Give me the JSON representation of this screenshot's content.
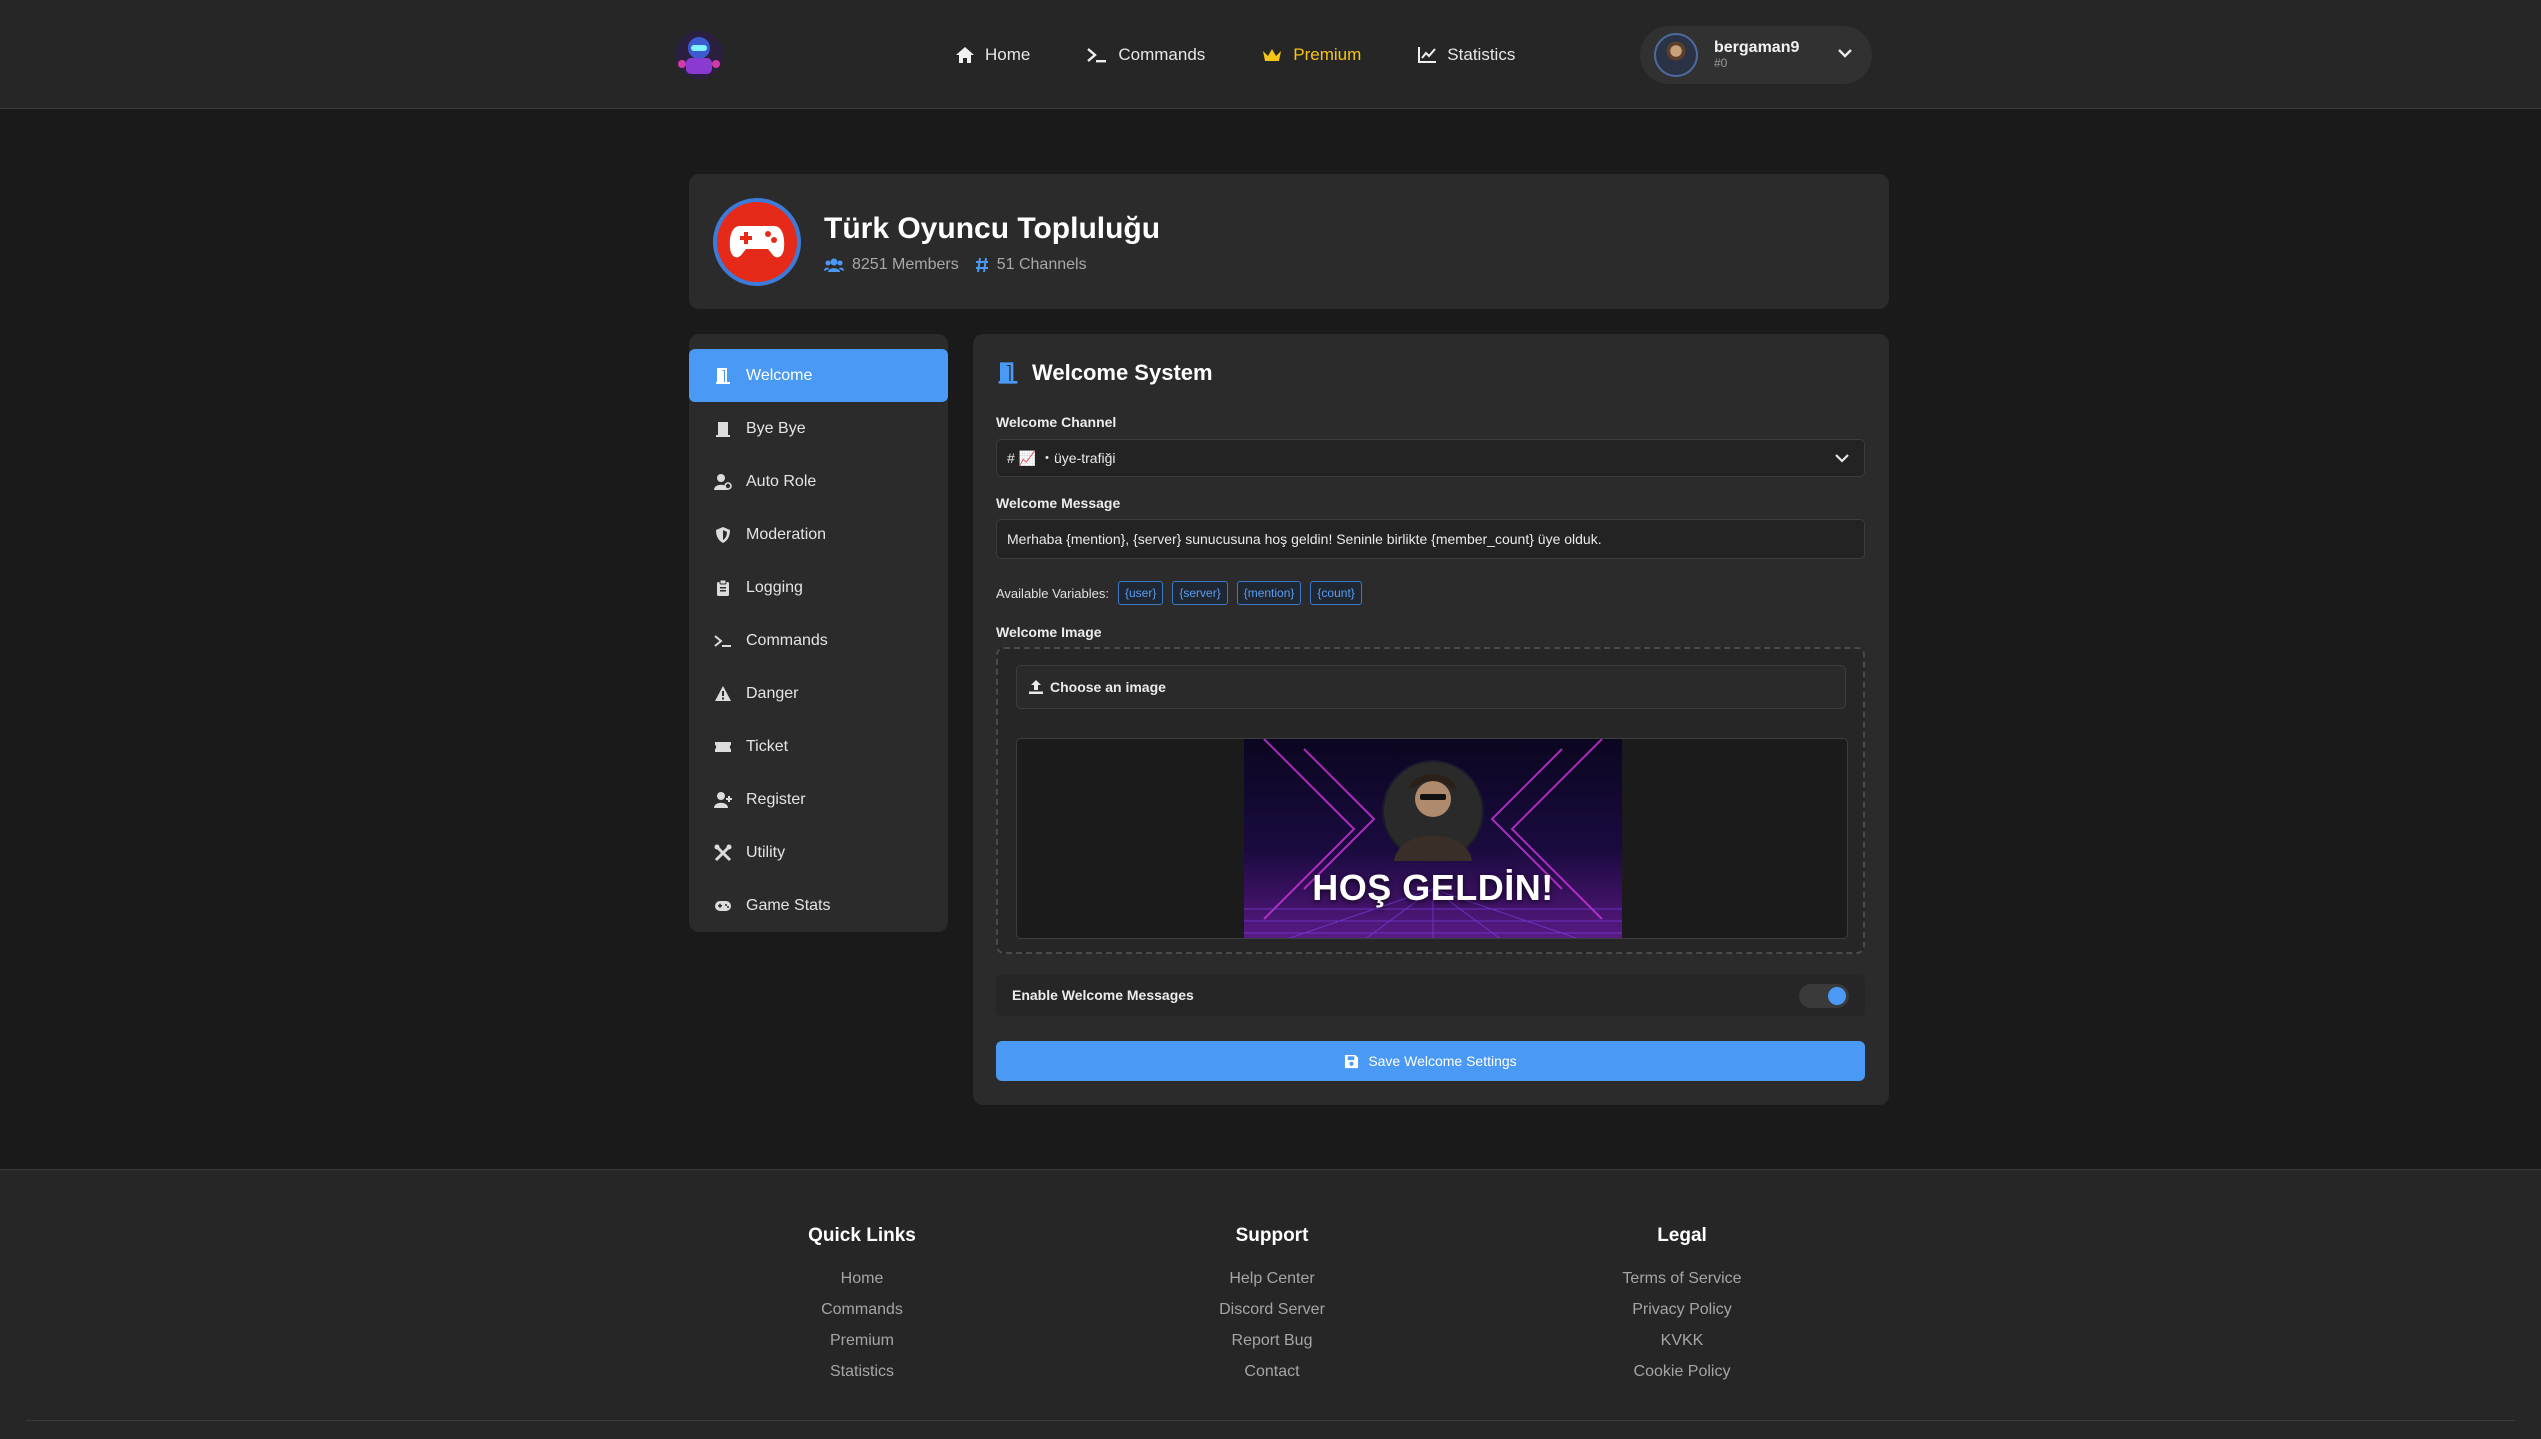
{
  "nav": {
    "links": [
      {
        "label": "Home",
        "icon": "home-icon"
      },
      {
        "label": "Commands",
        "icon": "terminal-icon"
      },
      {
        "label": "Premium",
        "icon": "crown-icon",
        "color": "#f5c518"
      },
      {
        "label": "Statistics",
        "icon": "chart-line-icon"
      }
    ],
    "user": {
      "name": "bergaman9",
      "tag": "#0"
    }
  },
  "server": {
    "name": "Türk Oyuncu Topluluğu",
    "members": "8251 Members",
    "channels": "51 Channels"
  },
  "sidebar": {
    "items": [
      {
        "label": "Welcome",
        "icon": "door-open-icon",
        "active": true
      },
      {
        "label": "Bye Bye",
        "icon": "door-closed-icon"
      },
      {
        "label": "Auto Role",
        "icon": "user-gear-icon"
      },
      {
        "label": "Moderation",
        "icon": "shield-icon"
      },
      {
        "label": "Logging",
        "icon": "clipboard-icon"
      },
      {
        "label": "Commands",
        "icon": "terminal-icon"
      },
      {
        "label": "Danger",
        "icon": "warning-icon"
      },
      {
        "label": "Ticket",
        "icon": "ticket-icon"
      },
      {
        "label": "Register",
        "icon": "user-plus-icon"
      },
      {
        "label": "Utility",
        "icon": "tools-icon"
      },
      {
        "label": "Game Stats",
        "icon": "gamepad-icon"
      }
    ]
  },
  "welcome": {
    "title": "Welcome System",
    "channel_label": "Welcome Channel",
    "channel_value": "# 📈 ・üye-trafiği",
    "message_label": "Welcome Message",
    "message_value": "Merhaba {mention}, {server} sunucusuna hoş geldin! Seninle birlikte {member_count} üye olduk.",
    "vars_label": "Available Variables:",
    "variables": [
      "{user}",
      "{server}",
      "{mention}",
      "{count}"
    ],
    "image_label": "Welcome Image",
    "choose_label": "Choose an image",
    "banner_text": "HOŞ GELDİN!",
    "toggle_label": "Enable Welcome Messages",
    "toggle_on": true,
    "save_label": "Save Welcome Settings"
  },
  "footer": {
    "columns": [
      {
        "title": "Quick Links",
        "links": [
          "Home",
          "Commands",
          "Premium",
          "Statistics"
        ]
      },
      {
        "title": "Support",
        "links": [
          "Help Center",
          "Discord Server",
          "Report Bug",
          "Contact"
        ]
      },
      {
        "title": "Legal",
        "links": [
          "Terms of Service",
          "Privacy Policy",
          "KVKK",
          "Cookie Policy"
        ]
      }
    ]
  },
  "colors": {
    "accent": "#4a9af5",
    "premium": "#f5c518",
    "background": "#1a1a1a",
    "card": "#2b2b2b"
  }
}
